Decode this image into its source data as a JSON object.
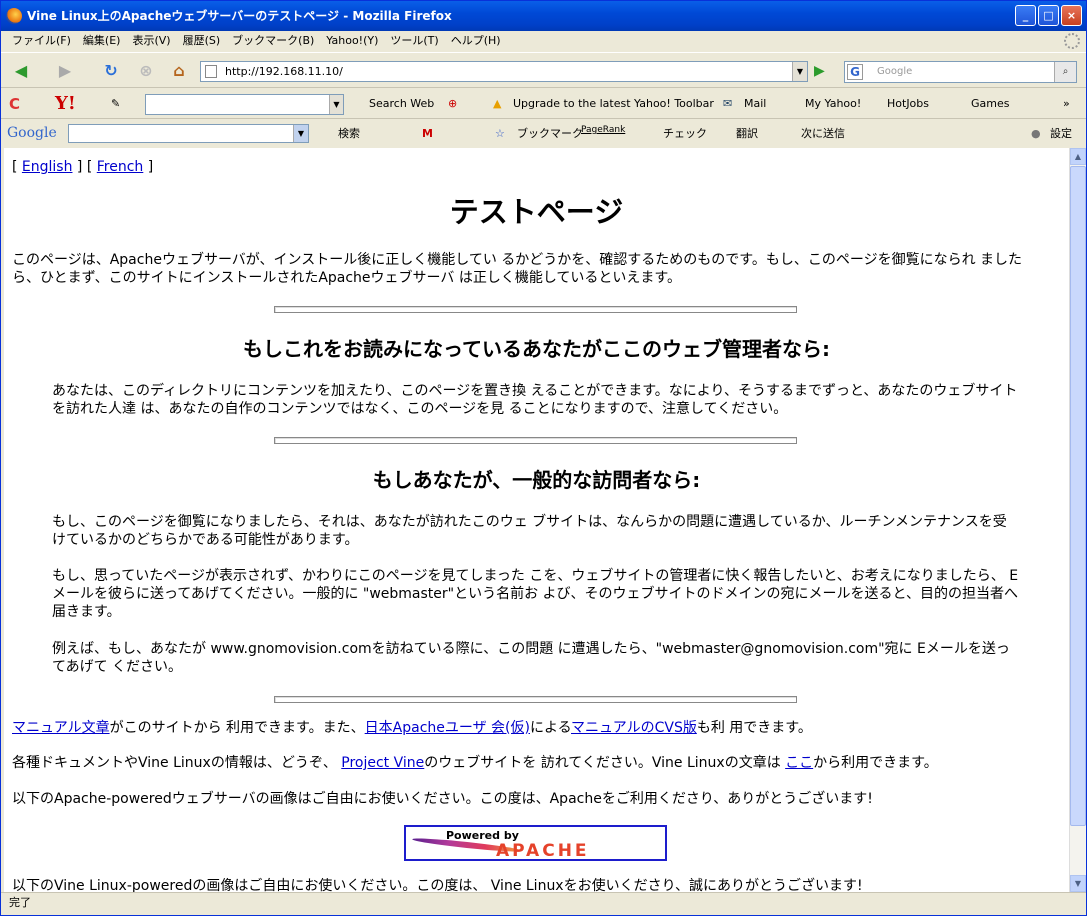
{
  "window": {
    "title": "Vine Linux上のApacheウェブサーバーのテストページ - Mozilla Firefox",
    "min": "_",
    "max": "□",
    "close": "×"
  },
  "menu": [
    "ファイル(F)",
    "編集(E)",
    "表示(V)",
    "履歴(S)",
    "ブックマーク(B)",
    "Yahoo!(Y)",
    "ツール(T)",
    "ヘルプ(H)"
  ],
  "nav": {
    "url": "http://192.168.11.10/",
    "search_placeholder": "Google",
    "go": "▶"
  },
  "yahoo_toolbar": {
    "search_web": "Search Web",
    "upgrade": "Upgrade to the latest Yahoo! Toolbar",
    "mail": "Mail",
    "my_yahoo": "My Yahoo!",
    "hotjobs": "HotJobs",
    "games": "Games",
    "more": "»"
  },
  "google_toolbar": {
    "logo": "Google",
    "search": "検索",
    "bookmarks": "ブックマーク",
    "pagerank": "PageRank",
    "check": "チェック",
    "translate": "翻訳",
    "sendto": "次に送信",
    "settings": "設定"
  },
  "page": {
    "lang_open": "[ ",
    "english": "English",
    "lang_mid": " ] [ ",
    "french": "French",
    "lang_close": " ]",
    "h1": "テストページ",
    "intro": "このページは、Apacheウェブサーバが、インストール後に正しく機能してい るかどうかを、確認するためのものです。もし、このページを御覧になられ ましたら、ひとまず、このサイトにインストールされたApacheウェブサーバ は正しく機能しているといえます。",
    "h2_admin": "もしこれをお読みになっているあなたがここのウェブ管理者なら:",
    "admin_text": "あなたは、このディレクトリにコンテンツを加えたり、このページを置き換 えることができます。なにより、そうするまでずっと、あなたのウェブサイトを訪れた人達 は、あなたの自作のコンテンツではなく、このページを見 ることになりますので、注意してください。",
    "h2_visitor": "もしあなたが、一般的な訪問者なら:",
    "visitor1": "もし、このページを御覧になりましたら、それは、あなたが訪れたこのウェ ブサイトは、なんらかの問題に遭遇しているか、ルーチンメンテナンスを受 けているかのどちらかである可能性があります。",
    "visitor2": "もし、思っていたページが表示されず、かわりにこのページを見てしまった こを、ウェブサイトの管理者に快く報告したいと、お考えになりましたら、 Eメールを彼らに送ってあげてください。一般的に \"webmaster\"という名前お よび、そのウェブサイトのドメインの宛にメールを送ると、目的の担当者へ 届きます。",
    "visitor3": "例えば、もし、あなたが www.gnomovision.comを訪ねている際に、この問題 に遭遇したら、\"webmaster@gnomovision.com\"宛に Eメールを送ってあげて ください。",
    "manual_link": "マニュアル文章",
    "manual_t1": "がこのサイトから 利用できます。また、",
    "jp_users_link": "日本Apacheユーザ 会(仮)",
    "manual_t2": "による",
    "cvs_link": "マニュアルのCVS版",
    "manual_t3": "も利 用できます。",
    "vine_t1": "各種ドキュメントやVine Linuxの情報は、どうぞ、 ",
    "project_vine_link": "Project Vine",
    "vine_t2": "のウェブサイトを 訪れてください。Vine Linuxの文章は ",
    "koko_link": "ここ",
    "vine_t3": "から利用できます。",
    "apache_powered": "以下のApache-poweredウェブサーバの画像はご自由にお使いください。この度は、Apacheをご利用くださり、ありがとうございます!",
    "pb_powered": "Powered by",
    "pb_apache": "APACHE",
    "vine_powered": "以下のVine Linux-poweredの画像はご自由にお使いください。この度は、 Vine Linuxをお使いくださり、誠にありがとうございます!"
  },
  "status": "完了"
}
